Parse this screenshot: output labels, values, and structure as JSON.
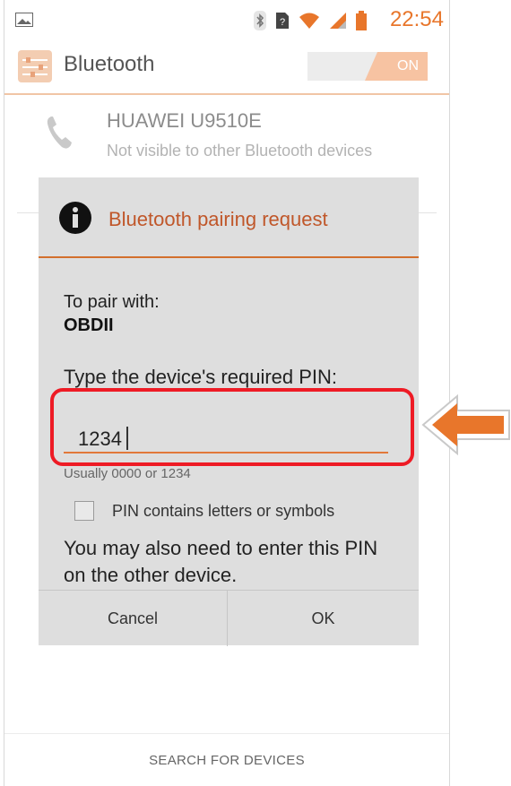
{
  "status_bar": {
    "time": "22:54",
    "icons": [
      "image-icon",
      "bluetooth-icon",
      "sim-icon",
      "wifi-icon",
      "signal-icon",
      "battery-icon"
    ]
  },
  "action_bar": {
    "title": "Bluetooth",
    "toggle_label": "ON"
  },
  "device": {
    "name": "HUAWEI U9510E",
    "status": "Not visible to other Bluetooth devices"
  },
  "dialog": {
    "title": "Bluetooth pairing request",
    "pair_label": "To pair with:",
    "pair_device": "OBDII",
    "pin_prompt": "Type the device's required PIN:",
    "pin_value": "1234",
    "pin_hint": "Usually 0000 or 1234",
    "checkbox_label": "PIN contains letters or symbols",
    "checkbox_checked": false,
    "note": "You may also need to enter this PIN on the other device.",
    "cancel_label": "Cancel",
    "ok_label": "OK"
  },
  "bottom": {
    "search_label": "SEARCH FOR DEVICES"
  },
  "colors": {
    "accent": "#e8762b",
    "dialog_title": "#c0572a",
    "highlight": "#ee1b25",
    "arrow": "#e8762b"
  }
}
